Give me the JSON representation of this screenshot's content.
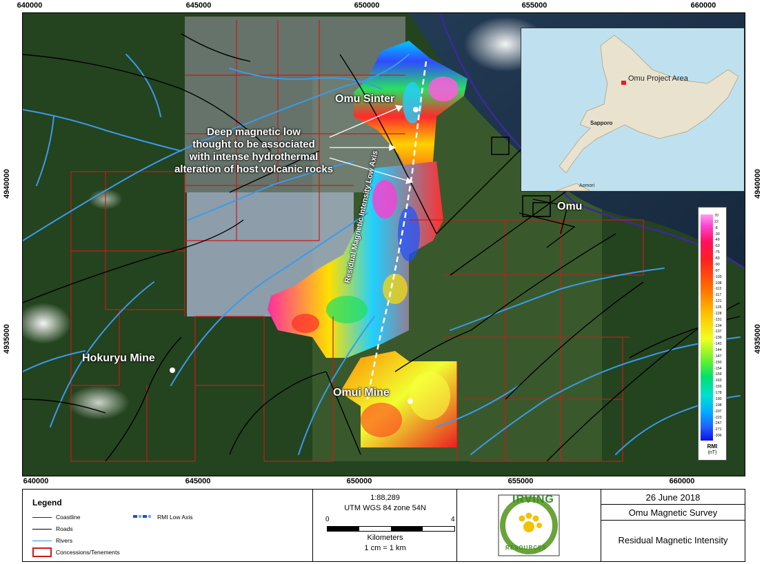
{
  "axes": {
    "x_ticks": [
      "640000",
      "645000",
      "650000",
      "655000",
      "660000"
    ],
    "y_ticks": [
      "4940000",
      "4935000"
    ]
  },
  "map_labels": {
    "omu_sinter": "Omu Sinter",
    "omu": "Omu",
    "hokuryu_mine": "Hokuryu Mine",
    "omui_mine": "Omui Mine",
    "axis_label": "Residual Magnetic Intensity Low Axis",
    "annotation_lines": [
      "Deep magnetic low",
      "thought to be associated",
      "with intense hydrothermal",
      "alteration of host volcanic rocks"
    ]
  },
  "inset": {
    "project_area": "Omu Project Area",
    "sapporo": "Sapporo",
    "aomori": "Aomori"
  },
  "rmi_scale": {
    "ticks": [
      "70",
      "22",
      "-8",
      "-30",
      "-49",
      "-63",
      "-75",
      "-83",
      "-90",
      "-97",
      "-103",
      "-108",
      "-113",
      "-117",
      "-121",
      "-125",
      "-128",
      "-131",
      "-134",
      "-137",
      "-139",
      "-142",
      "-144",
      "-147",
      "-150",
      "-154",
      "-159",
      "-163",
      "-169",
      "-178",
      "-190",
      "-198",
      "-207",
      "-223",
      "-247",
      "-271",
      "-306"
    ],
    "unit_line1": "RMI",
    "unit_line2": "(nT)"
  },
  "legend": {
    "title": "Legend",
    "coastline": "Coastline",
    "roads": "Roads",
    "rivers": "Rivers",
    "concessions": "Concessions/Tenements",
    "rmi_low_axis": "RMI Low Axis",
    "colors": {
      "coastline": "#1d1d8f",
      "roads": "#000000",
      "rivers": "#2f8fe0",
      "concessions": "#cc1a1a"
    }
  },
  "scale": {
    "ratio": "1:88,289",
    "projection": "UTM WGS 84 zone 54N",
    "start": "0",
    "end": "4",
    "units": "Kilometers",
    "equivalence": "1 cm = 1 km"
  },
  "logo": {
    "word_top": "IRVING",
    "word_bottom": "RESOURCES"
  },
  "title_block": {
    "date": "26 June 2018",
    "survey": "Omu Magnetic Survey",
    "subject": "Residual Magnetic Intensity"
  }
}
